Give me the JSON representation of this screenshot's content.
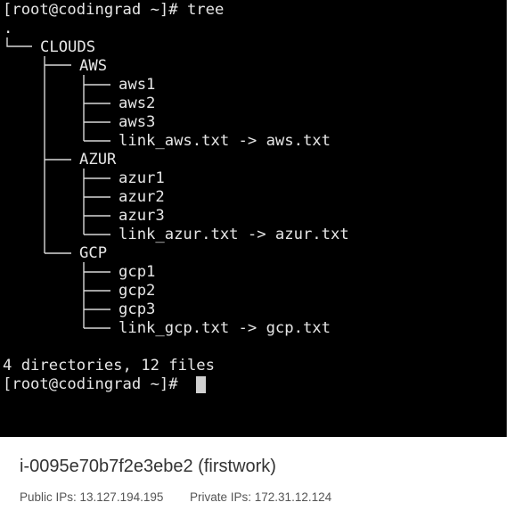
{
  "terminal": {
    "prompt_command": "[root@codingrad ~]# tree",
    "root_dot": ".",
    "clouds": "CLOUDS",
    "aws": "AWS",
    "aws1": "aws1",
    "aws2": "aws2",
    "aws3": "aws3",
    "link_aws": "link_aws.txt -> aws.txt",
    "azur": "AZUR",
    "azur1": "azur1",
    "azur2": "azur2",
    "azur3": "azur3",
    "link_azur": "link_azur.txt -> azur.txt",
    "gcp": "GCP",
    "gcp1": "gcp1",
    "gcp2": "gcp2",
    "gcp3": "gcp3",
    "link_gcp": "link_gcp.txt -> gcp.txt",
    "summary": "4 directories, 12 files",
    "prompt_idle": "[root@codingrad ~]# "
  },
  "instance": {
    "title": "i-0095e70b7f2e3ebe2 (firstwork)",
    "public_ips": "Public IPs: 13.127.194.195",
    "private_ips": "Private IPs: 172.31.12.124"
  }
}
